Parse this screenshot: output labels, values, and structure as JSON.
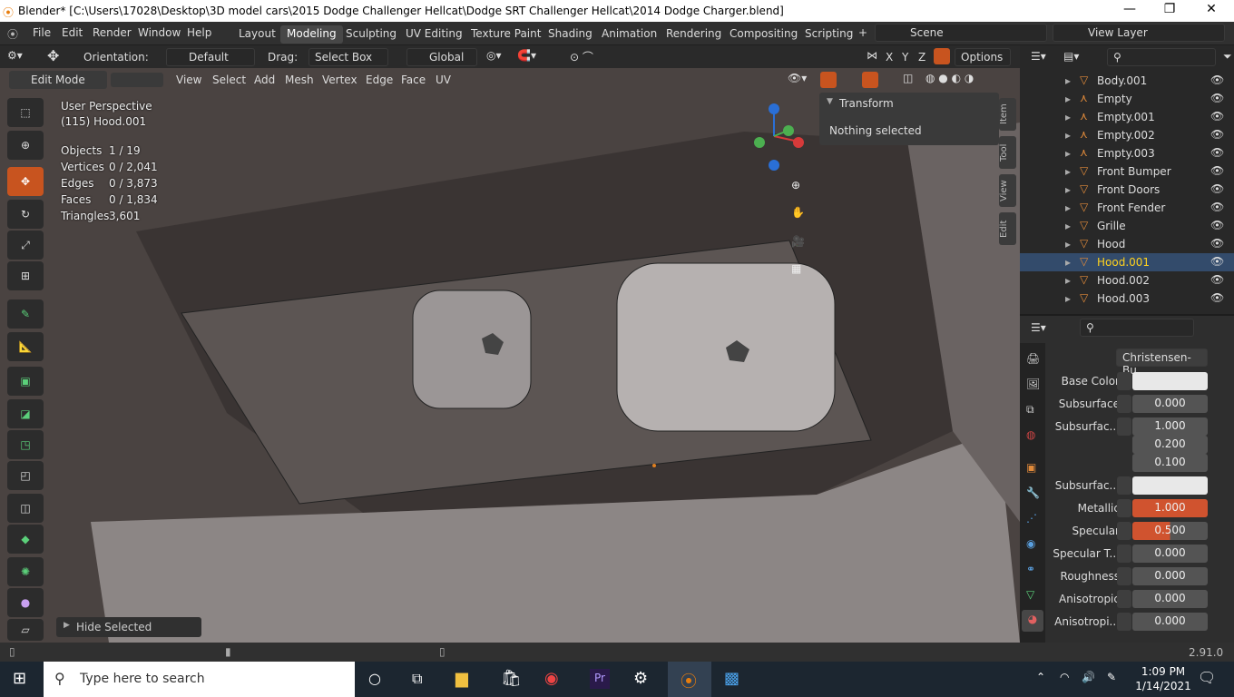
{
  "window": {
    "title": "Blender* [C:\\Users\\17028\\Desktop\\3D model cars\\2015 Dodge Challenger Hellcat\\Dodge SRT Challenger Hellcat\\2014 Dodge Charger.blend]",
    "min": "—",
    "max": "❐",
    "close": "✕"
  },
  "menus": [
    "File",
    "Edit",
    "Render",
    "Window",
    "Help"
  ],
  "workspaces": [
    "Layout",
    "Modeling",
    "Sculpting",
    "UV Editing",
    "Texture Paint",
    "Shading",
    "Animation",
    "Rendering",
    "Compositing",
    "Scripting"
  ],
  "active_workspace": "Modeling",
  "scene": "Scene",
  "view_layer": "View Layer",
  "toolhdr": {
    "orientation_label": "Orientation:",
    "orientation": "Default",
    "drag_label": "Drag:",
    "drag": "Select Box",
    "transform": "Global",
    "xyz": [
      "X",
      "Y",
      "Z"
    ],
    "options": "Options"
  },
  "viewhdr": {
    "mode": "Edit Mode",
    "items": [
      "View",
      "Select",
      "Add",
      "Mesh",
      "Vertex",
      "Edge",
      "Face",
      "UV"
    ]
  },
  "overlay": {
    "view": "User Perspective",
    "object": "(115) Hood.001",
    "stats": [
      {
        "k": "Objects",
        "v": "1 / 19"
      },
      {
        "k": "Vertices",
        "v": "0 / 2,041"
      },
      {
        "k": "Edges",
        "v": "0 / 3,873"
      },
      {
        "k": "Faces",
        "v": "0 / 1,834"
      },
      {
        "k": "Triangles",
        "v": "3,601"
      }
    ]
  },
  "transform_panel": {
    "title": "Transform",
    "msg": "Nothing selected"
  },
  "side_tabs": [
    "Item",
    "Tool",
    "View",
    "Edit"
  ],
  "hide_selected": "Hide Selected",
  "outliner": [
    {
      "name": "Body.001"
    },
    {
      "name": "Empty"
    },
    {
      "name": "Empty.001"
    },
    {
      "name": "Empty.002"
    },
    {
      "name": "Empty.003"
    },
    {
      "name": "Front Bumper"
    },
    {
      "name": "Front Doors"
    },
    {
      "name": "Front Fender"
    },
    {
      "name": "Grille"
    },
    {
      "name": "Hood"
    },
    {
      "name": "Hood.001",
      "selected": true
    },
    {
      "name": "Hood.002"
    },
    {
      "name": "Hood.003"
    }
  ],
  "props": {
    "dropdown": "Christensen-Bu...",
    "rows": [
      {
        "label": "Base Color",
        "value": ""
      },
      {
        "label": "Subsurface",
        "value": "0.000"
      },
      {
        "label": "Subsurfac...",
        "value": "1.000"
      },
      {
        "label": "",
        "value": "0.200"
      },
      {
        "label": "",
        "value": "0.100"
      },
      {
        "label": "Subsurfac...",
        "value": ""
      },
      {
        "label": "Metallic",
        "value": "1.000"
      },
      {
        "label": "Specular",
        "value": "0.500"
      },
      {
        "label": "Specular T...",
        "value": "0.000"
      },
      {
        "label": "Roughness",
        "value": "0.000"
      },
      {
        "label": "Anisotropic",
        "value": "0.000"
      },
      {
        "label": "Anisotropi...",
        "value": "0.000"
      }
    ]
  },
  "status": {
    "version": "2.91.0"
  },
  "taskbar": {
    "search": "Type here to search",
    "time": "1:09 PM",
    "date": "1/14/2021"
  },
  "colors": {
    "accent": "#c8541f",
    "selected_text": "#ffd21e",
    "blender_orange": "#e87d0d"
  }
}
